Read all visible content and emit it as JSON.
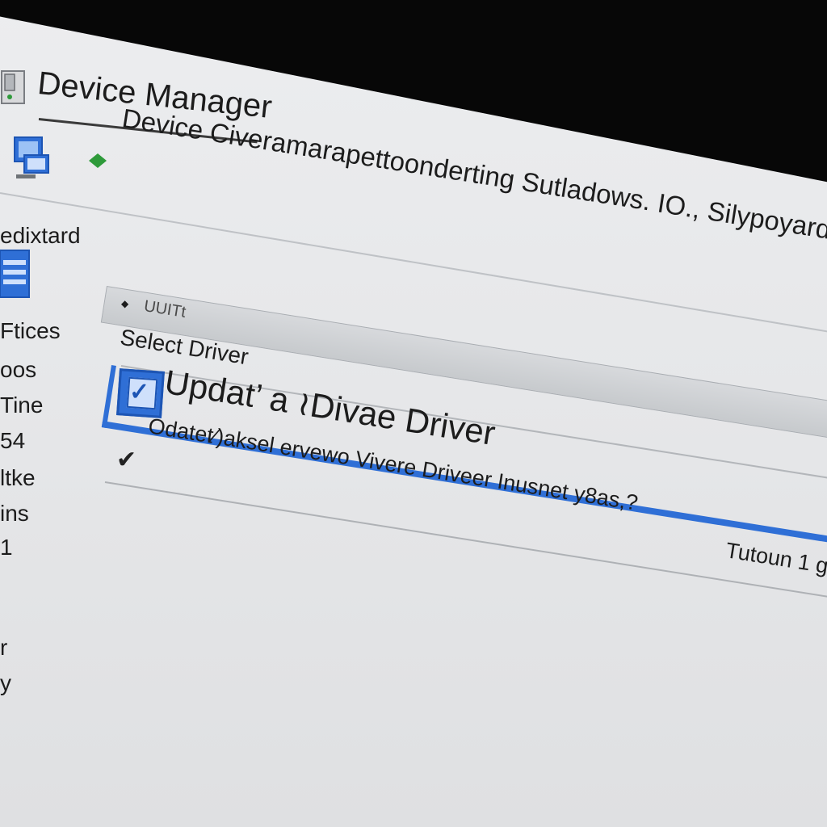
{
  "window": {
    "title": "Device Manager",
    "subtitle": "Device Civeramarapettoonderting Sutladows. IO., Silypoyarde"
  },
  "sidebar": {
    "items": [
      {
        "label": "edixtard"
      },
      {
        "label": "Ftices"
      },
      {
        "label": "oos"
      },
      {
        "label": "Tine"
      },
      {
        "label": "54"
      },
      {
        "label": "ltke"
      },
      {
        "label": "ins"
      },
      {
        "label": "1"
      },
      {
        "label": "r"
      },
      {
        "label": "y"
      }
    ]
  },
  "toolbar": {
    "label": "UUITt"
  },
  "dialog": {
    "heading": "Select Driver",
    "selected_option": "Updat’ a ≀Divae Driver",
    "option": {
      "text": "Odatet⁄)aksel ervewo Vivere Driveer Inusnet y8as,?",
      "right_text": "Tutoun 1 g"
    }
  },
  "icons": {
    "app": "device-manager-app-icon",
    "computer": "computer-monitor-icon",
    "arrow": "green-arrow-icon",
    "checkbox": "checkbox-checked-icon",
    "check": "checkmark-icon"
  },
  "colors": {
    "accent": "#2f6fd6",
    "screen_bg": "#e9eaec",
    "bezel": "#070707",
    "arrow_green": "#2e9a3a"
  }
}
